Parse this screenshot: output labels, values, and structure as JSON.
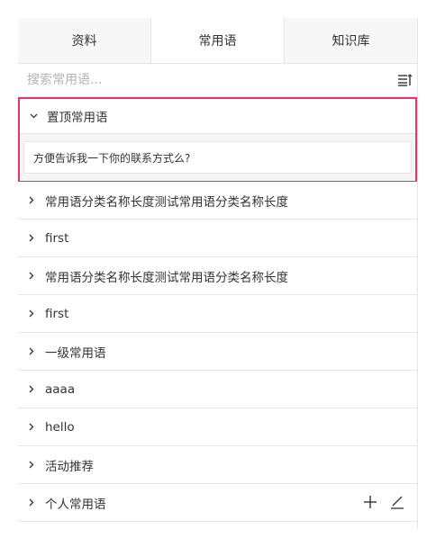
{
  "tabs": [
    {
      "label": "资料",
      "active": false
    },
    {
      "label": "常用语",
      "active": true
    },
    {
      "label": "知识库",
      "active": false
    }
  ],
  "search": {
    "placeholder": "搜索常用语...",
    "value": ""
  },
  "pinned": {
    "title": "置顶常用语",
    "expanded": true,
    "highlight_color": "#e8336e",
    "phrases": [
      "方便告诉我一下你的联系方式么?"
    ]
  },
  "categories": [
    {
      "label": "常用语分类名称长度测试常用语分类名称长度"
    },
    {
      "label": "first"
    },
    {
      "label": "常用语分类名称长度测试常用语分类名称长度"
    },
    {
      "label": "first"
    },
    {
      "label": "一级常用语"
    },
    {
      "label": "aaaa"
    },
    {
      "label": "hello"
    },
    {
      "label": "活动推荐"
    },
    {
      "label": "个人常用语"
    }
  ],
  "icons": {
    "sort": "sort-list-icon",
    "expanded": "chevron-down-icon",
    "collapsed": "chevron-right-icon",
    "add": "plus-icon",
    "edit": "edit-pen-icon"
  }
}
